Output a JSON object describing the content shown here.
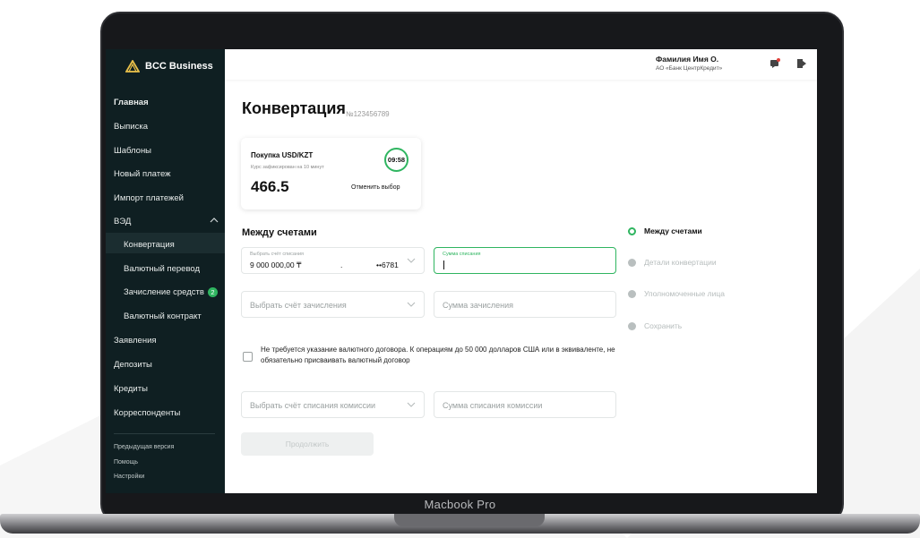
{
  "device_label": "Macbook Pro",
  "app": {
    "logo_text": "BCC Business"
  },
  "header": {
    "user_name": "Фамилия Имя О.",
    "user_org": "АО «Банк ЦентрКредит»"
  },
  "sidebar": {
    "items": [
      {
        "label": "Главная"
      },
      {
        "label": "Выписка"
      },
      {
        "label": "Шаблоны"
      },
      {
        "label": "Новый платеж"
      },
      {
        "label": "Импорт платежей"
      },
      {
        "label": "ВЭД"
      },
      {
        "label": "Конвертация"
      },
      {
        "label": "Валютный перевод"
      },
      {
        "label": "Зачисление средств",
        "badge": "2"
      },
      {
        "label": "Валютный контракт"
      },
      {
        "label": "Заявления"
      },
      {
        "label": "Депозиты"
      },
      {
        "label": "Кредиты"
      },
      {
        "label": "Корреспонденты"
      }
    ],
    "footer": {
      "prev_version": "Предыдущая версия",
      "help": "Помощь",
      "settings": "Настройки"
    }
  },
  "page": {
    "title": "Конвертация",
    "number": "№123456789"
  },
  "rate_card": {
    "pair": "Покупка USD/KZT",
    "fixed_note": "Курс зафиксирован на 10 минут",
    "rate": "466.5",
    "timer": "09:58",
    "cancel_label": "Отменить выбор"
  },
  "form": {
    "section_title": "Между счетами",
    "debit_account": {
      "label": "Выбрать счёт списания",
      "amount": "9 000 000,00 ₸",
      "separator": ".",
      "account_suffix": "••6781"
    },
    "debit_amount": {
      "label": "Сумма списания",
      "value": ""
    },
    "credit_account": {
      "placeholder": "Выбрать счёт зачисления"
    },
    "credit_amount": {
      "placeholder": "Сумма зачисления"
    },
    "checkbox": {
      "checked": false,
      "text": "Не требуется указание валютного договора. К операциям до 50 000 долларов США или в эквиваленте, не обязательно присваивать валютный договор"
    },
    "commission_account": {
      "placeholder": "Выбрать счёт списания комиссии"
    },
    "commission_amount": {
      "placeholder": "Сумма списания комиссии"
    },
    "continue_label": "Продолжить"
  },
  "stepper": {
    "steps": [
      {
        "label": "Между счетами",
        "state": "current"
      },
      {
        "label": "Детали конвертации",
        "state": "todo"
      },
      {
        "label": "Уполномоченные лица",
        "state": "todo"
      },
      {
        "label": "Сохранить",
        "state": "todo"
      }
    ]
  },
  "colors": {
    "accent": "#2fb560",
    "sidebar_bg": "#0f1f22",
    "device_frame": "#17181b"
  }
}
